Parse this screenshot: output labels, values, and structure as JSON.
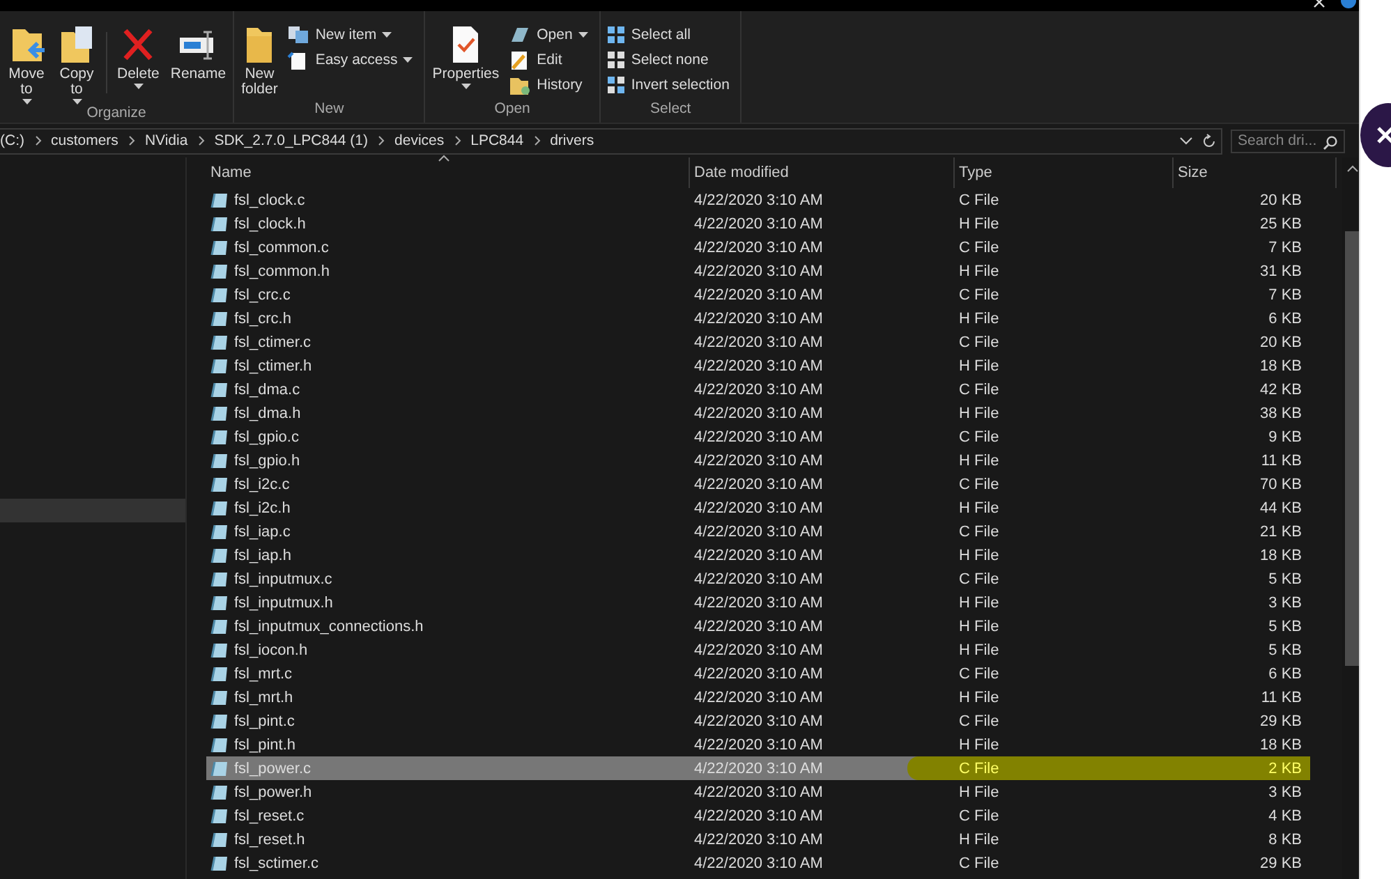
{
  "ribbon": {
    "groups": [
      {
        "label": "Organize",
        "buttons": [
          {
            "kind": "move",
            "label": "Move\nto",
            "dropdown": true
          },
          {
            "kind": "copy",
            "label": "Copy\nto",
            "dropdown": true
          },
          {
            "kind": "delete",
            "label": "Delete",
            "dropdown": true
          },
          {
            "kind": "rename",
            "label": "Rename",
            "dropdown": false
          }
        ]
      },
      {
        "label": "New",
        "buttons": [
          {
            "kind": "folder",
            "label": "New\nfolder",
            "dropdown": false
          }
        ],
        "small": [
          {
            "kind": "newitem",
            "label": "New item",
            "dropdown": true
          },
          {
            "kind": "easy",
            "label": "Easy access",
            "dropdown": true
          }
        ]
      },
      {
        "label": "Open",
        "buttons": [
          {
            "kind": "properties",
            "label": "Properties",
            "dropdown": true
          }
        ],
        "small": [
          {
            "kind": "open",
            "label": "Open",
            "dropdown": true
          },
          {
            "kind": "edit",
            "label": "Edit",
            "dropdown": false
          },
          {
            "kind": "history",
            "label": "History",
            "dropdown": false
          }
        ]
      },
      {
        "label": "Select",
        "small": [
          {
            "kind": "selall",
            "label": "Select all",
            "dropdown": false
          },
          {
            "kind": "selnone",
            "label": "Select none",
            "dropdown": false
          },
          {
            "kind": "invert",
            "label": "Invert selection",
            "dropdown": false
          }
        ]
      }
    ]
  },
  "address": {
    "path": [
      "(C:)",
      "customers",
      "NVidia",
      "SDK_2.7.0_LPC844 (1)",
      "devices",
      "LPC844",
      "drivers"
    ]
  },
  "search": {
    "placeholder": "Search dri..."
  },
  "table": {
    "columns": [
      "Name",
      "Date modified",
      "Type",
      "Size"
    ],
    "rows": [
      {
        "name": "fsl_clock.c",
        "date": "4/22/2020 3:10 AM",
        "type": "C File",
        "size": "20 KB",
        "selected": false,
        "marked": false
      },
      {
        "name": "fsl_clock.h",
        "date": "4/22/2020 3:10 AM",
        "type": "H File",
        "size": "25 KB",
        "selected": false,
        "marked": false
      },
      {
        "name": "fsl_common.c",
        "date": "4/22/2020 3:10 AM",
        "type": "C File",
        "size": "7 KB",
        "selected": false,
        "marked": false
      },
      {
        "name": "fsl_common.h",
        "date": "4/22/2020 3:10 AM",
        "type": "H File",
        "size": "31 KB",
        "selected": false,
        "marked": false
      },
      {
        "name": "fsl_crc.c",
        "date": "4/22/2020 3:10 AM",
        "type": "C File",
        "size": "7 KB",
        "selected": false,
        "marked": false
      },
      {
        "name": "fsl_crc.h",
        "date": "4/22/2020 3:10 AM",
        "type": "H File",
        "size": "6 KB",
        "selected": false,
        "marked": false
      },
      {
        "name": "fsl_ctimer.c",
        "date": "4/22/2020 3:10 AM",
        "type": "C File",
        "size": "20 KB",
        "selected": false,
        "marked": false
      },
      {
        "name": "fsl_ctimer.h",
        "date": "4/22/2020 3:10 AM",
        "type": "H File",
        "size": "18 KB",
        "selected": false,
        "marked": false
      },
      {
        "name": "fsl_dma.c",
        "date": "4/22/2020 3:10 AM",
        "type": "C File",
        "size": "42 KB",
        "selected": false,
        "marked": false
      },
      {
        "name": "fsl_dma.h",
        "date": "4/22/2020 3:10 AM",
        "type": "H File",
        "size": "38 KB",
        "selected": false,
        "marked": false
      },
      {
        "name": "fsl_gpio.c",
        "date": "4/22/2020 3:10 AM",
        "type": "C File",
        "size": "9 KB",
        "selected": false,
        "marked": false
      },
      {
        "name": "fsl_gpio.h",
        "date": "4/22/2020 3:10 AM",
        "type": "H File",
        "size": "11 KB",
        "selected": false,
        "marked": false
      },
      {
        "name": "fsl_i2c.c",
        "date": "4/22/2020 3:10 AM",
        "type": "C File",
        "size": "70 KB",
        "selected": false,
        "marked": false
      },
      {
        "name": "fsl_i2c.h",
        "date": "4/22/2020 3:10 AM",
        "type": "H File",
        "size": "44 KB",
        "selected": false,
        "marked": false
      },
      {
        "name": "fsl_iap.c",
        "date": "4/22/2020 3:10 AM",
        "type": "C File",
        "size": "21 KB",
        "selected": false,
        "marked": false
      },
      {
        "name": "fsl_iap.h",
        "date": "4/22/2020 3:10 AM",
        "type": "H File",
        "size": "18 KB",
        "selected": false,
        "marked": false
      },
      {
        "name": "fsl_inputmux.c",
        "date": "4/22/2020 3:10 AM",
        "type": "C File",
        "size": "5 KB",
        "selected": false,
        "marked": false
      },
      {
        "name": "fsl_inputmux.h",
        "date": "4/22/2020 3:10 AM",
        "type": "H File",
        "size": "3 KB",
        "selected": false,
        "marked": false
      },
      {
        "name": "fsl_inputmux_connections.h",
        "date": "4/22/2020 3:10 AM",
        "type": "H File",
        "size": "5 KB",
        "selected": false,
        "marked": false
      },
      {
        "name": "fsl_iocon.h",
        "date": "4/22/2020 3:10 AM",
        "type": "H File",
        "size": "5 KB",
        "selected": false,
        "marked": false
      },
      {
        "name": "fsl_mrt.c",
        "date": "4/22/2020 3:10 AM",
        "type": "C File",
        "size": "6 KB",
        "selected": false,
        "marked": false
      },
      {
        "name": "fsl_mrt.h",
        "date": "4/22/2020 3:10 AM",
        "type": "H File",
        "size": "11 KB",
        "selected": false,
        "marked": false
      },
      {
        "name": "fsl_pint.c",
        "date": "4/22/2020 3:10 AM",
        "type": "C File",
        "size": "29 KB",
        "selected": false,
        "marked": false
      },
      {
        "name": "fsl_pint.h",
        "date": "4/22/2020 3:10 AM",
        "type": "H File",
        "size": "18 KB",
        "selected": false,
        "marked": false
      },
      {
        "name": "fsl_power.c",
        "date": "4/22/2020 3:10 AM",
        "type": "C File",
        "size": "2 KB",
        "selected": true,
        "marked": true
      },
      {
        "name": "fsl_power.h",
        "date": "4/22/2020 3:10 AM",
        "type": "H File",
        "size": "3 KB",
        "selected": false,
        "marked": false
      },
      {
        "name": "fsl_reset.c",
        "date": "4/22/2020 3:10 AM",
        "type": "C File",
        "size": "4 KB",
        "selected": false,
        "marked": false
      },
      {
        "name": "fsl_reset.h",
        "date": "4/22/2020 3:10 AM",
        "type": "H File",
        "size": "8 KB",
        "selected": false,
        "marked": false
      },
      {
        "name": "fsl_sctimer.c",
        "date": "4/22/2020 3:10 AM",
        "type": "C File",
        "size": "29 KB",
        "selected": false,
        "marked": false
      }
    ]
  },
  "nav": {
    "items": [
      {
        "selected": true
      }
    ]
  }
}
